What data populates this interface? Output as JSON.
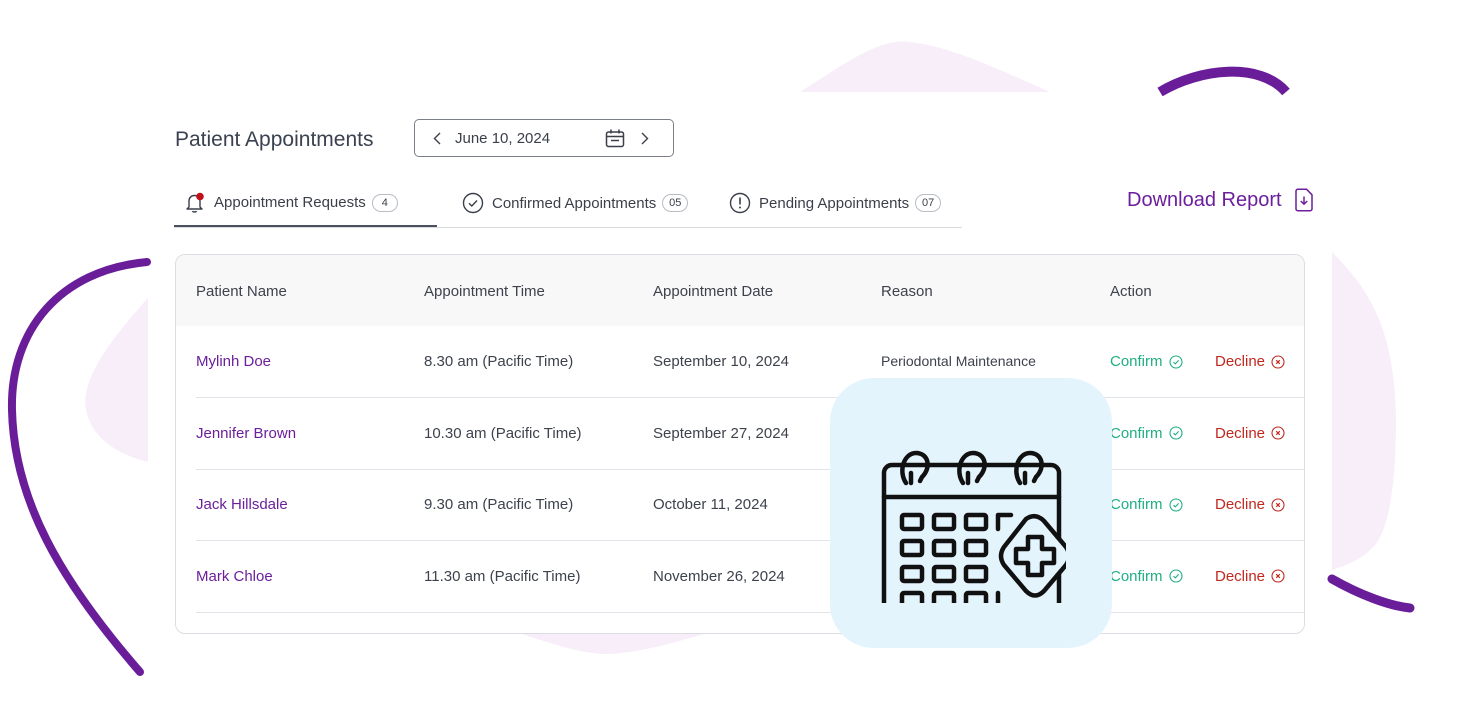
{
  "header": {
    "title": "Patient Appointments",
    "date_picker": {
      "value": "June 10, 2024",
      "prev_icon": "chevron-left-icon",
      "next_icon": "chevron-right-icon",
      "calendar_icon": "calendar-icon"
    }
  },
  "tabs": [
    {
      "label": "Appointment Requests",
      "count": "4",
      "icon": "bell-icon",
      "active": true,
      "has_notification_dot": true
    },
    {
      "label": "Confirmed Appointments",
      "count": "05",
      "icon": "check-circle-icon",
      "active": false
    },
    {
      "label": "Pending Appointments",
      "count": "07",
      "icon": "exclamation-circle-icon",
      "active": false
    }
  ],
  "download": {
    "label": "Download Report",
    "icon": "file-download-icon"
  },
  "table": {
    "columns": [
      "Patient Name",
      "Appointment Time",
      "Appointment Date",
      "Reason",
      "Action"
    ],
    "rows": [
      {
        "name": "Mylinh Doe",
        "time": "8.30 am (Pacific Time)",
        "date": "September 10, 2024",
        "reason": "Periodontal Maintenance",
        "confirm": "Confirm",
        "decline": "Decline"
      },
      {
        "name": "Jennifer Brown",
        "time": "10.30 am (Pacific Time)",
        "date": "September 27, 2024",
        "reason": "",
        "confirm": "Confirm",
        "decline": "Decline"
      },
      {
        "name": "Jack Hillsdale",
        "time": "9.30 am (Pacific Time)",
        "date": "October 11, 2024",
        "reason": "",
        "confirm": "Confirm",
        "decline": "Decline"
      },
      {
        "name": "Mark Chloe",
        "time": "11.30 am (Pacific Time)",
        "date": "November 26, 2024",
        "reason": "",
        "confirm": "Confirm",
        "decline": "Decline"
      }
    ]
  },
  "overlay": {
    "icon": "medical-calendar-icon"
  },
  "colors": {
    "brand_purple": "#6b1f9c",
    "confirm_green": "#1fae83",
    "decline_red": "#c0281e",
    "blob_pink": "#f8eefa",
    "tile_blue": "#e4f4fd",
    "notification_red": "#c0101a"
  }
}
